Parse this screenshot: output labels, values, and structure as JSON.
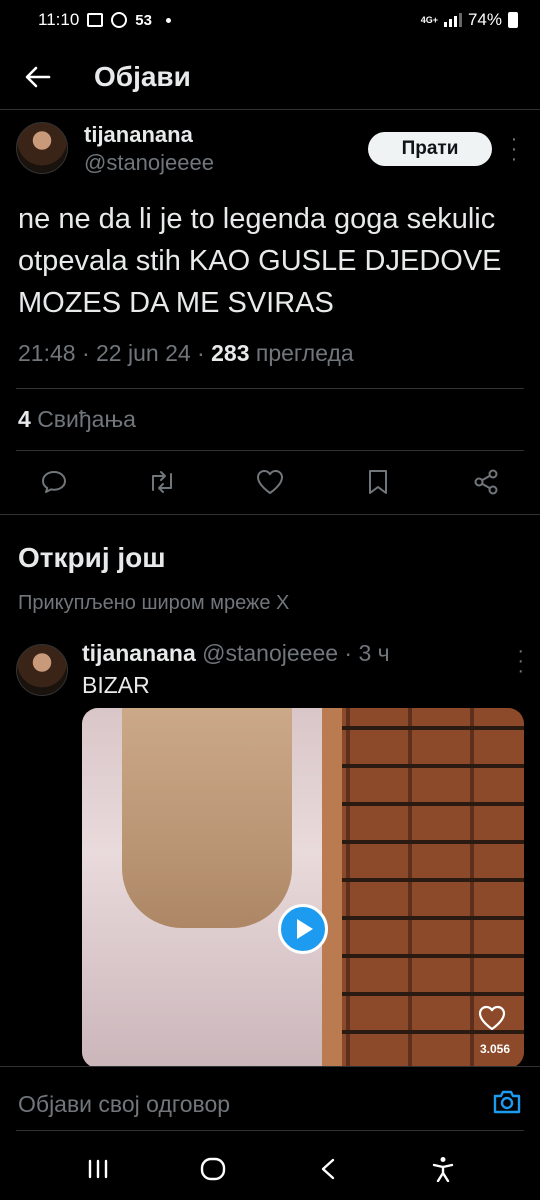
{
  "status_bar": {
    "time": "11:10",
    "whatsapp_count": "53",
    "network": "4G+",
    "battery": "74%"
  },
  "header": {
    "title": "Објави"
  },
  "tweet": {
    "display_name": "tijananana",
    "handle": "@stanojeeee",
    "follow_label": "Прати",
    "text": "ne ne da li je to legenda goga sekulic otpevala stih KAO GUSLE DJEDOVE MOZES DA ME SVIRAS",
    "time": "21:48",
    "date": "22 jun 24",
    "views_count": "283",
    "views_label": "прегледа",
    "likes_count": "4",
    "likes_label": "Свиђања"
  },
  "discover": {
    "title": "Откриј још",
    "subtitle": "Прикупљено широм мреже X"
  },
  "recommended": {
    "display_name": "tijananana",
    "handle_time": "@stanojeeee · 3 ч",
    "text": "BIZAR",
    "video_likes": "3.056"
  },
  "reply": {
    "placeholder": "Објави свој одговор"
  },
  "icons": {
    "reply": "reply-icon",
    "repost": "repost-icon",
    "like": "heart-icon",
    "bookmark": "bookmark-icon",
    "share": "share-icon",
    "camera": "camera-icon"
  },
  "colors": {
    "accent": "#1d9bf0",
    "text": "#e7e9ea",
    "muted": "#71767b",
    "divider": "#2f3336"
  }
}
